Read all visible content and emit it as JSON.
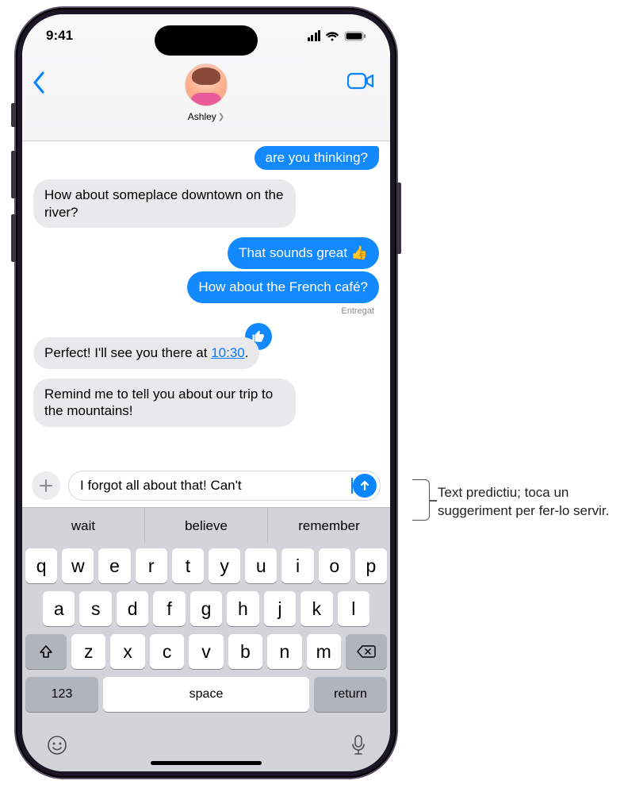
{
  "status": {
    "time": "9:41"
  },
  "header": {
    "contact_name": "Ashley"
  },
  "messages": {
    "m0": "are you thinking?",
    "m1": "How about someplace downtown on the river?",
    "m2": "That sounds great 👍",
    "m3": "How about the French café?",
    "delivered": "Entregat",
    "m4_prefix": "Perfect! I'll see you there at ",
    "m4_time": "10:30",
    "m4_suffix": ".",
    "m5": "Remind me to tell you about our trip to the mountains!"
  },
  "input": {
    "text": "I forgot all about that! Can't "
  },
  "predictive": {
    "p1": "wait",
    "p2": "believe",
    "p3": "remember"
  },
  "keyboard": {
    "row1": [
      "q",
      "w",
      "e",
      "r",
      "t",
      "y",
      "u",
      "i",
      "o",
      "p"
    ],
    "row2": [
      "a",
      "s",
      "d",
      "f",
      "g",
      "h",
      "j",
      "k",
      "l"
    ],
    "row3": [
      "z",
      "x",
      "c",
      "v",
      "b",
      "n",
      "m"
    ],
    "k123": "123",
    "space": "space",
    "return": "return"
  },
  "callout": {
    "text": "Text predictiu; toca un suggeriment per fer-lo servir."
  }
}
